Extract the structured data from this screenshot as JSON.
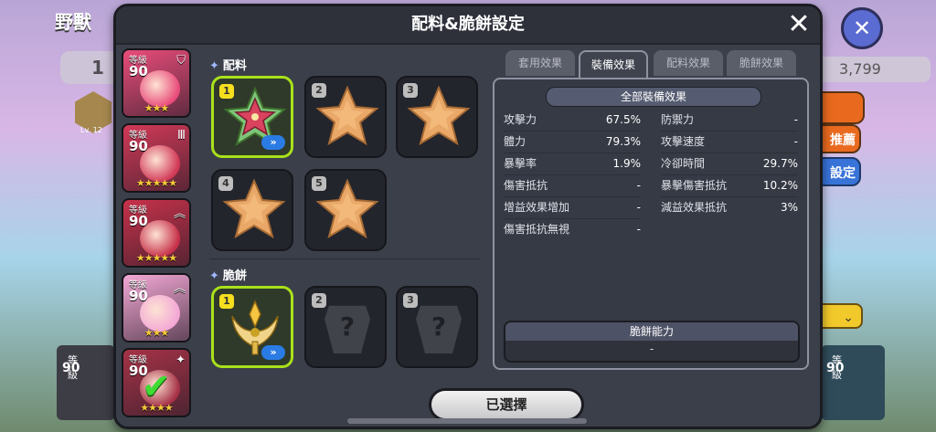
{
  "background": {
    "title": "野獸",
    "left_count": "1",
    "level_badge": "Lv. 12",
    "right_value": "3,799",
    "right_btn_recommend": "推薦",
    "right_btn_settings": "設定",
    "bottom_left_level_label": "等級",
    "bottom_left_level": "90",
    "bottom_right_level_label": "等級",
    "bottom_right_level": "90"
  },
  "modal": {
    "title": "配料&脆餅設定",
    "close_icon": "close-icon"
  },
  "characters": [
    {
      "level_label": "等級",
      "level": "90",
      "rank_icon": "shield-icon",
      "stars": "★★★",
      "color": "#e94c7a"
    },
    {
      "level_label": "等級",
      "level": "90",
      "rank_icon": "rank-icon",
      "stars": "★★★★★",
      "color": "#d23957"
    },
    {
      "level_label": "等級",
      "level": "90",
      "rank_icon": "chevron-up-icon",
      "stars": "★★★★★",
      "color": "#c7314a"
    },
    {
      "level_label": "等級",
      "level": "90",
      "rank_icon": "chevron-up-icon",
      "stars": "★★★",
      "color": "#f3a8d5"
    },
    {
      "level_label": "等級",
      "level": "90",
      "rank_icon": "star-icon",
      "stars": "★★★★",
      "color": "#a63247",
      "selected": true
    }
  ],
  "toppings_section": {
    "label": "配料",
    "slots": [
      {
        "num": "1",
        "state": "equipped",
        "more": "»"
      },
      {
        "num": "2",
        "state": "empty"
      },
      {
        "num": "3",
        "state": "empty"
      },
      {
        "num": "4",
        "state": "empty"
      },
      {
        "num": "5",
        "state": "empty"
      }
    ]
  },
  "tart_section": {
    "label": "脆餅",
    "slots": [
      {
        "num": "1",
        "state": "equipped",
        "more": "»"
      },
      {
        "num": "2",
        "state": "locked",
        "mark": "?"
      },
      {
        "num": "3",
        "state": "locked",
        "mark": "?"
      }
    ]
  },
  "tabs": [
    {
      "label": "套用效果",
      "active": false
    },
    {
      "label": "裝備效果",
      "active": true
    },
    {
      "label": "配料效果",
      "active": false
    },
    {
      "label": "脆餅效果",
      "active": false
    }
  ],
  "stats": {
    "title": "全部裝備效果",
    "left": [
      {
        "k": "攻擊力",
        "v": "67.5%"
      },
      {
        "k": "體力",
        "v": "79.3%"
      },
      {
        "k": "暴擊率",
        "v": "1.9%"
      },
      {
        "k": "傷害抵抗",
        "v": "-"
      },
      {
        "k": "增益效果增加",
        "v": "-"
      },
      {
        "k": "傷害抵抗無視",
        "v": "-"
      }
    ],
    "right": [
      {
        "k": "防禦力",
        "v": "-"
      },
      {
        "k": "攻擊速度",
        "v": "-"
      },
      {
        "k": "冷卻時間",
        "v": "29.7%"
      },
      {
        "k": "暴擊傷害抵抗",
        "v": "10.2%"
      },
      {
        "k": "減益效果抵抗",
        "v": "3%"
      }
    ],
    "ability_title": "脆餅能力",
    "ability_value": "-"
  },
  "select_button": "已選擇"
}
